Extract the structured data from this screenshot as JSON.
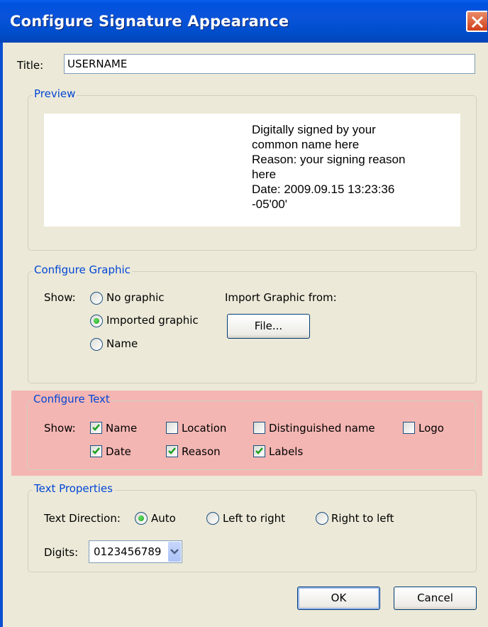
{
  "window": {
    "title": "Configure Signature Appearance"
  },
  "title_field": {
    "label": "Title:",
    "value": "USERNAME"
  },
  "preview": {
    "legend": "Preview",
    "lines": [
      "Digitally signed by your",
      "common name here",
      "Reason: your signing reason",
      "here",
      "Date: 2009.09.15 13:23:36",
      "-05'00'"
    ]
  },
  "configure_graphic": {
    "legend": "Configure Graphic",
    "show_label": "Show:",
    "options": [
      {
        "label": "No graphic",
        "selected": false
      },
      {
        "label": "Imported graphic",
        "selected": true
      },
      {
        "label": "Name",
        "selected": false
      }
    ],
    "import_label": "Import Graphic from:",
    "file_button": "File..."
  },
  "configure_text": {
    "legend": "Configure Text",
    "show_label": "Show:",
    "items": [
      {
        "label": "Name",
        "checked": true
      },
      {
        "label": "Location",
        "checked": false
      },
      {
        "label": "Distinguished name",
        "checked": false
      },
      {
        "label": "Logo",
        "checked": false
      },
      {
        "label": "Date",
        "checked": true
      },
      {
        "label": "Reason",
        "checked": true
      },
      {
        "label": "Labels",
        "checked": true
      }
    ],
    "highlight_color": "#f4b6b3"
  },
  "text_properties": {
    "legend": "Text Properties",
    "direction_label": "Text Direction:",
    "directions": [
      {
        "label": "Auto",
        "selected": true
      },
      {
        "label": "Left to right",
        "selected": false
      },
      {
        "label": "Right to left",
        "selected": false
      }
    ],
    "digits_label": "Digits:",
    "digits_value": "0123456789"
  },
  "buttons": {
    "ok": "OK",
    "cancel": "Cancel"
  },
  "colors": {
    "titlebar": "#0052df",
    "accent": "#0046d5",
    "dialog_bg": "#ece9d8",
    "close": "#d0401b"
  }
}
